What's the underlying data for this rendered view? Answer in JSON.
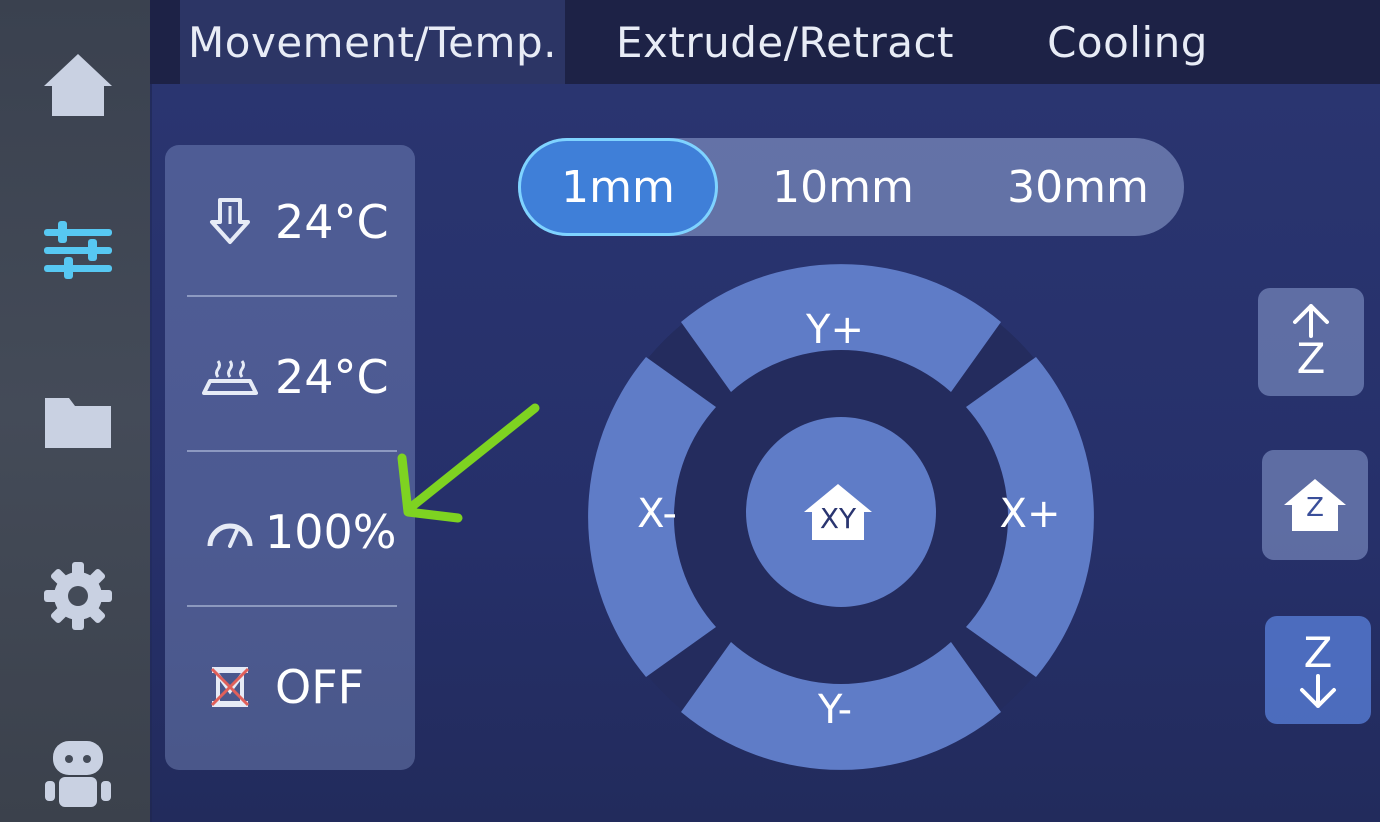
{
  "tabs": [
    {
      "label": "Movement/Temp."
    },
    {
      "label": "Extrude/Retract"
    },
    {
      "label": "Cooling"
    }
  ],
  "sidebar": {
    "items": [
      {
        "icon": "home-icon"
      },
      {
        "icon": "sliders-icon"
      },
      {
        "icon": "folder-icon"
      },
      {
        "icon": "gear-icon"
      },
      {
        "icon": "robot-icon"
      }
    ]
  },
  "status": {
    "nozzle_temp": "24°C",
    "bed_temp": "24°C",
    "speed": "100%",
    "motors": "OFF"
  },
  "step_sizes": {
    "options": [
      "1mm",
      "10mm",
      "30mm"
    ],
    "selected": "1mm"
  },
  "jog": {
    "y_plus": "Y+",
    "y_minus": "Y-",
    "x_minus": "X-",
    "x_plus": "X+",
    "home_xy": "XY"
  },
  "z_controls": {
    "up": "Z",
    "home": "Z",
    "down": "Z"
  },
  "colors": {
    "accent": "#57c8f2",
    "selected_step": "#3f7fd8",
    "annotation_arrow": "#7ed321"
  }
}
